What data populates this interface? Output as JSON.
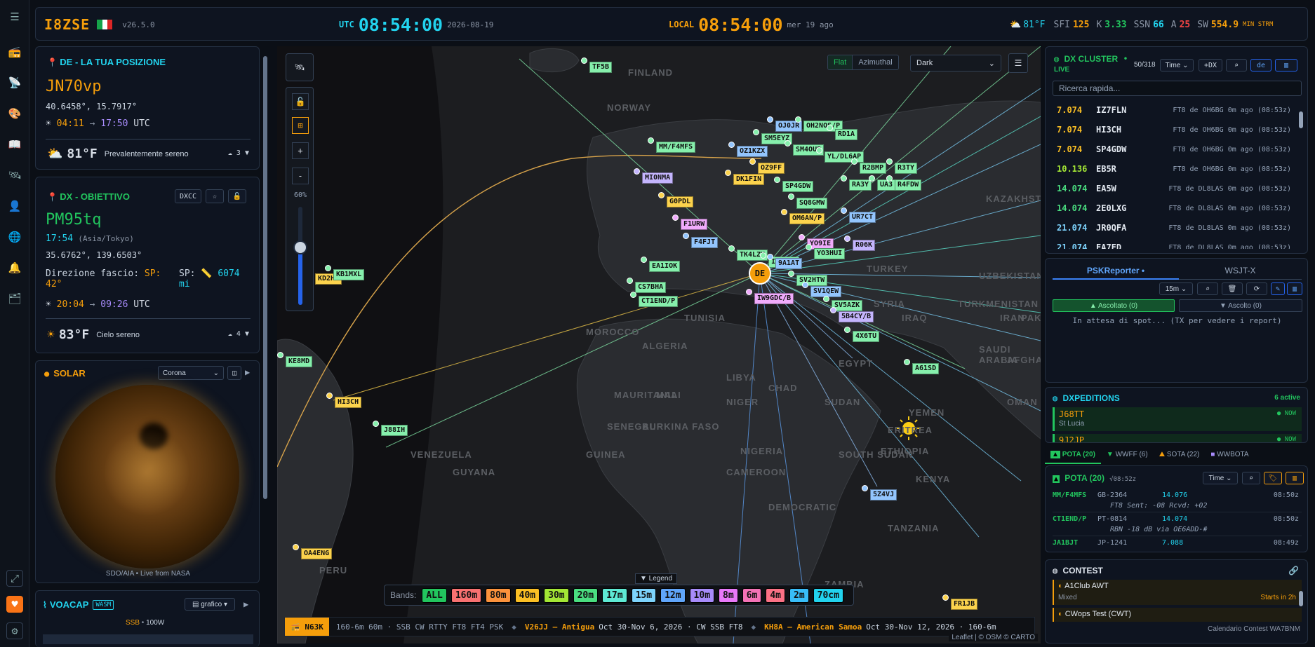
{
  "header": {
    "logo": "I8ZSE",
    "version": "v26.5.0",
    "utc_label": "UTC",
    "utc_time": "08:54:00",
    "utc_date": "2026-08-19",
    "local_label": "LOCAL",
    "local_time": "08:54:00",
    "local_date": "mer 19 ago",
    "weather": "81°F",
    "sfi_label": "SFI",
    "sfi": "125",
    "k_label": "K",
    "k": "3.33",
    "ssn_label": "SSN",
    "ssn": "66",
    "a_label": "A",
    "a": "25",
    "sw_label": "SW",
    "sw": "554.9",
    "sw_unit": "MIN STRM"
  },
  "de": {
    "title": "DE - LA TUA POSIZIONE",
    "grid": "JN70vp",
    "coords": "40.6458°, 15.7917°",
    "sun_rise": "04:11",
    "sun_set": "17:50",
    "sun_tz": "UTC",
    "temp": "81°F",
    "cond": "Prevalentemente sereno",
    "wind": "3"
  },
  "dx": {
    "title": "DX - OBIETTIVO",
    "dxcc_btn": "DXCC",
    "grid": "PM95tq",
    "time": "17:54",
    "tz": "(Asia/Tokyo)",
    "coords": "35.6762°, 139.6503°",
    "beam_label": "Direzione fascio:",
    "sp_label": "SP:",
    "sp_val": "42°",
    "sp2_label": "SP:",
    "dist": "6074",
    "dist_unit": "mi",
    "sun_rise": "20:04",
    "sun_set": "09:26",
    "sun_tz": "UTC",
    "temp": "83°F",
    "cond": "Cielo sereno",
    "wind": "4"
  },
  "solar": {
    "title": "SOLAR",
    "select": "Corona",
    "caption": "SDO/AIA • Live from NASA"
  },
  "voacap": {
    "title": "VOACAP",
    "badge": "WASM",
    "mode_btn": "grafico",
    "mode": "SSB",
    "power": "100W"
  },
  "map": {
    "view_flat": "Flat",
    "view_az": "Azimuthal",
    "theme": "Dark",
    "zoom_pct": "60%",
    "legend": "▼ Legend",
    "bands_label": "Bands:",
    "attribution": "Leaflet | © OSM © CARTO"
  },
  "bands": [
    {
      "label": "ALL",
      "color": "#22c55e"
    },
    {
      "label": "160m",
      "color": "#f87171"
    },
    {
      "label": "80m",
      "color": "#fb923c"
    },
    {
      "label": "40m",
      "color": "#fbbf24"
    },
    {
      "label": "30m",
      "color": "#a3e635"
    },
    {
      "label": "20m",
      "color": "#4ade80"
    },
    {
      "label": "17m",
      "color": "#5eead4"
    },
    {
      "label": "15m",
      "color": "#7dd3fc"
    },
    {
      "label": "12m",
      "color": "#60a5fa"
    },
    {
      "label": "10m",
      "color": "#a78bfa"
    },
    {
      "label": "8m",
      "color": "#e879f9"
    },
    {
      "label": "6m",
      "color": "#f472b6"
    },
    {
      "label": "4m",
      "color": "#fb7185"
    },
    {
      "label": "2m",
      "color": "#38bdf8"
    },
    {
      "label": "70cm",
      "color": "#22d3ee"
    }
  ],
  "ticker": {
    "tag": "N63K",
    "text1": "160-6m 60m · SSB CW RTTY FT8 FT4 PSK",
    "call2": "V26JJ — Antigua",
    "text2": "Oct 30-Nov 6, 2026 · CW SSB FT8",
    "call3": "KH8A — American Samoa",
    "text3": "Oct 30-Nov 12, 2026 · 160-6m"
  },
  "cluster": {
    "title": "DX CLUSTER",
    "live": "LIVE",
    "count": "50/318",
    "sort": "Time",
    "add_btn": "+DX",
    "search_ph": "Ricerca rapida...",
    "spots": [
      {
        "freq": "7.074",
        "call": "IZ7FLN",
        "info": "FT8 de OH6BG 0m ago (08:53z)"
      },
      {
        "freq": "7.074",
        "call": "HI3CH",
        "info": "FT8 de OH6BG 0m ago (08:53z)"
      },
      {
        "freq": "7.074",
        "call": "SP4GDW",
        "info": "FT8 de OH6BG 0m ago (08:53z)"
      },
      {
        "freq": "10.136",
        "call": "EB5R",
        "info": "FT8 de OH6BG 0m ago (08:53z)"
      },
      {
        "freq": "14.074",
        "call": "EA5W",
        "info": "FT8 de DL8LAS 0m ago (08:53z)"
      },
      {
        "freq": "14.074",
        "call": "2E0LXG",
        "info": "FT8 de DL8LAS 0m ago (08:53z)"
      },
      {
        "freq": "21.074",
        "call": "JR0QFA",
        "info": "FT8 de DL8LAS 0m ago (08:53z)"
      },
      {
        "freq": "21.074",
        "call": "EA7FD",
        "info": "FT8 de DL8LAS 0m ago (08:53z)"
      }
    ]
  },
  "psk": {
    "tab1": "PSKReporter •",
    "tab2": "WSJT-X",
    "band": "15m",
    "heard": "▲ Ascoltato (0)",
    "listen": "▼ Ascolto (0)",
    "waiting": "In attesa di spot... (TX per vedere i report)"
  },
  "dxped": {
    "title": "DXPEDITIONS",
    "active": "6 active",
    "items": [
      {
        "call": "J68TT",
        "name": "St Lucia",
        "status": "● NOW"
      },
      {
        "call": "9J2JP",
        "name": "",
        "status": "● NOW"
      }
    ]
  },
  "tabs": {
    "pota": "POTA (20)",
    "wwff": "WWFF (6)",
    "sota": "SOTA (22)",
    "wwbota": "WWBOTA"
  },
  "pota": {
    "title": "POTA (20)",
    "time": "√08:52z",
    "sort": "Time",
    "rows": [
      {
        "call": "MM/F4MFS",
        "ref": "GB-2364",
        "freq": "14.076",
        "t": "08:50z",
        "note": "FT8 Sent: -08 Rcvd: +02"
      },
      {
        "call": "CT1END/P",
        "ref": "PT-0814",
        "freq": "14.074",
        "t": "08:50z",
        "note": "RBN -18 dB via OE6ADD-#"
      },
      {
        "call": "JA1BJT",
        "ref": "JP-1241",
        "freq": "7.088",
        "t": "08:49z",
        "note": ""
      }
    ]
  },
  "contest": {
    "title": "CONTEST",
    "items": [
      {
        "name": "A1Club AWT",
        "mode": "Mixed",
        "when": "Starts in 2h"
      },
      {
        "name": "CWops Test (CWT)",
        "mode": "",
        "when": ""
      }
    ],
    "footer": "Calendario Contest WA7BNM"
  },
  "map_labels": [
    {
      "t": "TF5B",
      "c": "#86efac"
    },
    {
      "t": "MM/F4MFS",
      "c": "#86efac"
    },
    {
      "t": "OJ0JR",
      "c": "#93c5fd"
    },
    {
      "t": "OH2NOS/P",
      "c": "#86efac"
    },
    {
      "t": "RD1A",
      "c": "#86efac"
    },
    {
      "t": "SM5EYZ",
      "c": "#86efac"
    },
    {
      "t": "OZ1KZX",
      "c": "#93c5fd"
    },
    {
      "t": "SM4OUP",
      "c": "#86efac"
    },
    {
      "t": "YL/DL6AP",
      "c": "#86efac"
    },
    {
      "t": "OZ9FF",
      "c": "#fcd34d"
    },
    {
      "t": "R2BMP",
      "c": "#86efac"
    },
    {
      "t": "R3TY",
      "c": "#86efac"
    },
    {
      "t": "MI0NMA",
      "c": "#c4b5fd"
    },
    {
      "t": "DK1FIN",
      "c": "#fcd34d"
    },
    {
      "t": "SP4GDW",
      "c": "#86efac"
    },
    {
      "t": "RA3Y",
      "c": "#86efac"
    },
    {
      "t": "UA3",
      "c": "#86efac"
    },
    {
      "t": "R4FDW",
      "c": "#86efac"
    },
    {
      "t": "G0PDL",
      "c": "#fcd34d"
    },
    {
      "t": "SQ8GMW",
      "c": "#86efac"
    },
    {
      "t": "OM6AN/P",
      "c": "#fcd34d"
    },
    {
      "t": "UR7CT",
      "c": "#93c5fd"
    },
    {
      "t": "F1URW",
      "c": "#f0abfc"
    },
    {
      "t": "F4FJT",
      "c": "#93c5fd"
    },
    {
      "t": "YO9IE",
      "c": "#f0abfc"
    },
    {
      "t": "R06K",
      "c": "#c4b5fd"
    },
    {
      "t": "YO3HUI",
      "c": "#86efac"
    },
    {
      "t": "EA1IOK",
      "c": "#86efac"
    },
    {
      "t": "TK4LZH",
      "c": "#86efac"
    },
    {
      "t": "IZ7FLN",
      "c": "#86efac"
    },
    {
      "t": "9A1AT",
      "c": "#93c5fd"
    },
    {
      "t": "CS7BHA",
      "c": "#86efac"
    },
    {
      "t": "SV2HTW",
      "c": "#86efac"
    },
    {
      "t": "SV1QEW",
      "c": "#93c5fd"
    },
    {
      "t": "CT1END/P",
      "c": "#86efac"
    },
    {
      "t": "IW9GDC/B",
      "c": "#f0abfc"
    },
    {
      "t": "SV5AZK",
      "c": "#86efac"
    },
    {
      "t": "5B4CY/B",
      "c": "#c4b5fd"
    },
    {
      "t": "4X6TU",
      "c": "#86efac"
    },
    {
      "t": "A61SD",
      "c": "#86efac"
    },
    {
      "t": "5Z4VJ",
      "c": "#93c5fd"
    },
    {
      "t": "HI3CH",
      "c": "#fcd34d"
    },
    {
      "t": "J88IH",
      "c": "#86efac"
    },
    {
      "t": "KD2HE",
      "c": "#fcd34d"
    },
    {
      "t": "KB1MXL",
      "c": "#86efac"
    },
    {
      "t": "KE8MD",
      "c": "#86efac"
    },
    {
      "t": "OA4ENG",
      "c": "#fcd34d"
    },
    {
      "t": "FR1JB",
      "c": "#fcd34d"
    },
    {
      "t": "DE",
      "c": "#f59e0b"
    }
  ],
  "countries": [
    "FINLAND",
    "NORWAY",
    "KAZAKHSTAN",
    "UZBEKISTAN",
    "AFGHANISTAN",
    "TURKMENISTAN",
    "IRAN",
    "IRAQ",
    "SYRIA",
    "TURKEY",
    "PAKISTAN",
    "SAUDI ARABIA",
    "EGYPT",
    "LIBYA",
    "ALGERIA",
    "MOROCCO",
    "TUNISIA",
    "MAURITANIA",
    "MALI",
    "NIGER",
    "CHAD",
    "SUDAN",
    "ETHIOPIA",
    "YEMEN",
    "OMAN",
    "SOUTH SUDAN",
    "NIGERIA",
    "SENEGAL",
    "GUINEA",
    "BURKINA FASO",
    "CAMEROON",
    "DEMOCRATIC",
    "ZAMBIA",
    "TANZANIA",
    "KENYA",
    "VENEZUELA",
    "GUYANA",
    "PERU",
    "ERITREA"
  ]
}
